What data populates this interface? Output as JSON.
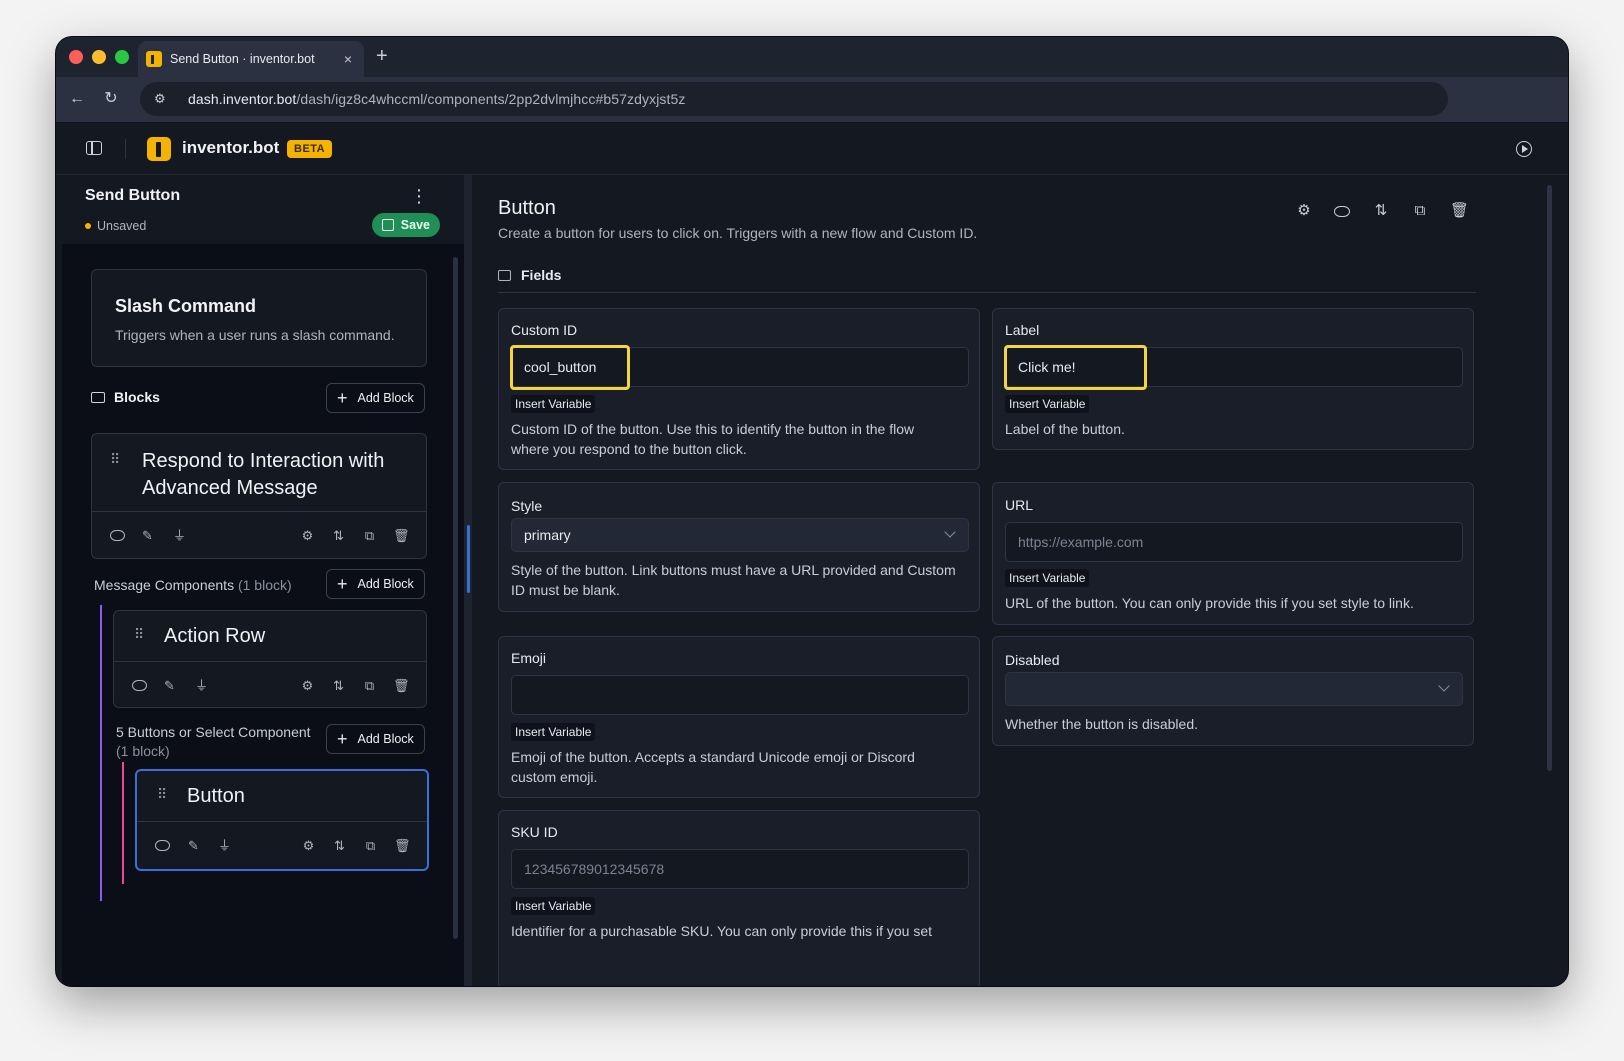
{
  "browser": {
    "tab_title": "Send Button · inventor.bot",
    "tab_close": "×",
    "new_tab": "+",
    "url_host": "dash.inventor.bot",
    "url_path": "/dash/igz8c4whccml/components/2pp2dvlmjhcc#b57zdyxjst5z",
    "back": "←",
    "reload": "↻",
    "site_info": "⚙"
  },
  "app": {
    "brand": "inventor.bot",
    "badge": "BETA"
  },
  "left": {
    "title": "Send Button",
    "kebab": "⋮",
    "status": "Unsaved",
    "save_label": "Save",
    "trigger": {
      "title": "Slash Command",
      "description": "Triggers when a user runs a slash command."
    },
    "blocks_label": "Blocks",
    "add_block_label": "Add Block",
    "plus": "+",
    "block_respond": {
      "title_line1": "Respond to Interaction with",
      "title_line2": "Advanced Message"
    },
    "message_components_label": "Message Components",
    "message_components_count": "(1 block)",
    "action_row_title": "Action Row",
    "buttons_section_line1": "5 Buttons or Select Component",
    "buttons_section_line2": "(1 block)",
    "button_block_title": "Button",
    "grip": "⠿"
  },
  "right": {
    "title": "Button",
    "description": "Create a button for users to click on. Triggers with a new flow and Custom ID.",
    "fields_label": "Fields",
    "insert_variable": "Insert Variable",
    "custom_id": {
      "label": "Custom ID",
      "value": "cool_button",
      "description_line1": "Custom ID of the button. Use this to identify the button in the flow",
      "description_line2": "where you respond to the button click."
    },
    "label_field": {
      "label": "Label",
      "value": "Click me!",
      "description": "Label of the button."
    },
    "style": {
      "label": "Style",
      "value": "primary",
      "description_line1": "Style of the button. Link buttons must have a URL provided and Custom",
      "description_line2": "ID must be blank."
    },
    "url": {
      "label": "URL",
      "placeholder": "https://example.com",
      "description": "URL of the button. You can only provide this if you set style to link."
    },
    "emoji": {
      "label": "Emoji",
      "value": "",
      "description_line1": "Emoji of the button. Accepts a standard Unicode emoji or Discord",
      "description_line2": "custom emoji."
    },
    "disabled": {
      "label": "Disabled",
      "value": "",
      "description": "Whether the button is disabled."
    },
    "sku_id": {
      "label": "SKU ID",
      "placeholder": "123456789012345678",
      "description": "Identifier for a purchasable SKU. You can only provide this if you set"
    }
  },
  "colors": {
    "accent": "#f5b301",
    "save": "#1f8f55",
    "selection": "#3b6fd8",
    "highlight": "#f5d442",
    "nest_purple": "#8b5cf6",
    "nest_pink": "#ec4899"
  }
}
